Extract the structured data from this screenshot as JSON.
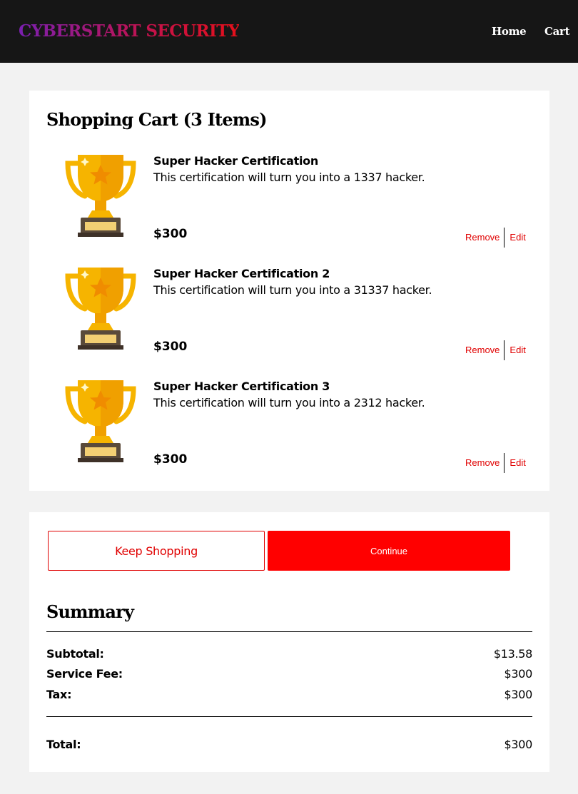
{
  "header": {
    "brand": "CYBERSTART SECURITY",
    "nav": {
      "home": "Home",
      "cart": "Cart"
    },
    "colors": {
      "background": "#161616",
      "brand_gradient": [
        "#7a1fb0",
        "#e4101a"
      ]
    }
  },
  "cart": {
    "title": "Shopping Cart (3 Items)",
    "items": [
      {
        "name": "Super Hacker Certification",
        "description": "This certification will turn you into a 1337 hacker.",
        "price": "$300",
        "image_icon": "trophy-icon",
        "remove_label": "Remove",
        "edit_label": "Edit"
      },
      {
        "name": "Super Hacker Certification 2",
        "description": "This certification will turn you into a 31337 hacker.",
        "price": "$300",
        "image_icon": "trophy-icon",
        "remove_label": "Remove",
        "edit_label": "Edit"
      },
      {
        "name": "Super Hacker Certification 3",
        "description": "This certification will turn you into a 2312 hacker.",
        "price": "$300",
        "image_icon": "trophy-icon",
        "remove_label": "Remove",
        "edit_label": "Edit"
      }
    ]
  },
  "actions": {
    "keep_shopping": "Keep Shopping",
    "continue": "Continue",
    "accent_color": "#ff0000"
  },
  "summary": {
    "title": "Summary",
    "subtotal_label": "Subtotal:",
    "subtotal_value": "$13.58",
    "service_fee_label": "Service Fee:",
    "service_fee_value": "$300",
    "tax_label": "Tax:",
    "tax_value": "$300",
    "total_label": "Total:",
    "total_value": "$300"
  }
}
